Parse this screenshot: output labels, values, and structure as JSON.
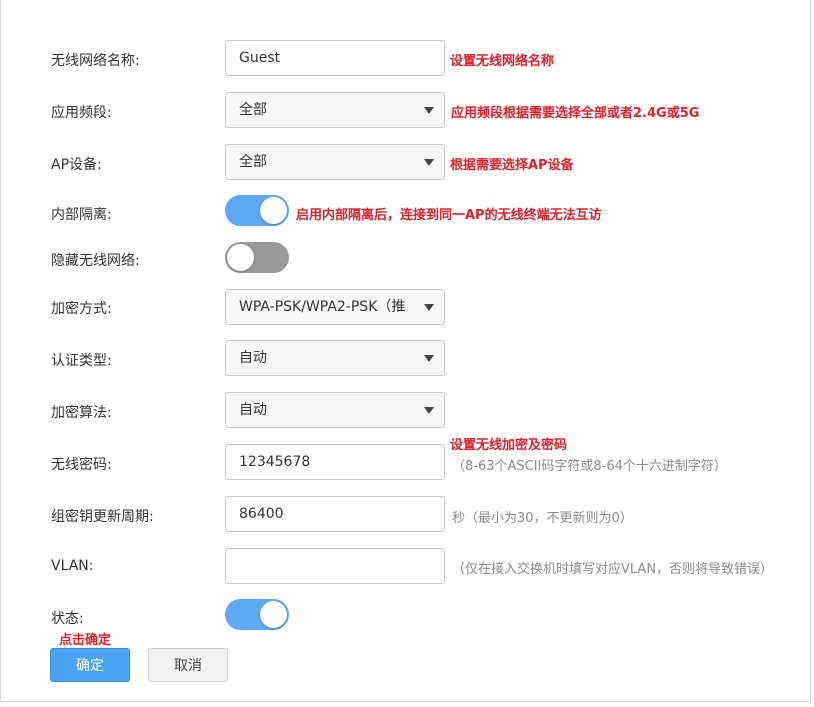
{
  "form": {
    "ssid": {
      "label": "无线网络名称:",
      "value": "Guest",
      "note": "设置无线网络名称"
    },
    "band": {
      "label": "应用频段:",
      "value": "全部",
      "note": "应用频段根据需要选择全部或者2.4G或5G"
    },
    "ap_device": {
      "label": "AP设备:",
      "value": "全部",
      "note": "根据需要选择AP设备"
    },
    "isolation": {
      "label": "内部隔离:",
      "state": "on",
      "note": "启用内部隔离后，连接到同一AP的无线终端无法互访"
    },
    "hide_ssid": {
      "label": "隐藏无线网络:",
      "state": "off"
    },
    "encryption": {
      "label": "加密方式:",
      "value": "WPA-PSK/WPA2-PSK（推"
    },
    "auth_type": {
      "label": "认证类型:",
      "value": "自动"
    },
    "cipher": {
      "label": "加密算法:",
      "value": "自动"
    },
    "password": {
      "label": "无线密码:",
      "value": "12345678",
      "note": "设置无线加密及密码",
      "hint": "（8-63个ASCII码字符或8-64个十六进制字符）"
    },
    "group_key": {
      "label": "组密钥更新周期:",
      "value": "86400",
      "hint": "秒（最小为30，不更新则为0）"
    },
    "vlan": {
      "label": "VLAN:",
      "value": "",
      "hint": "（仅在接入交换机时填写对应VLAN，否则将导致错误）"
    },
    "status": {
      "label": "状态:",
      "state": "on"
    }
  },
  "buttons": {
    "confirm_note": "点击确定",
    "confirm": "确定",
    "cancel": "取消"
  },
  "colors": {
    "accent": "#4aa3f2",
    "toggle_on": "#5fa8f2",
    "toggle_off": "#999999",
    "annotation": "#e0202a"
  }
}
